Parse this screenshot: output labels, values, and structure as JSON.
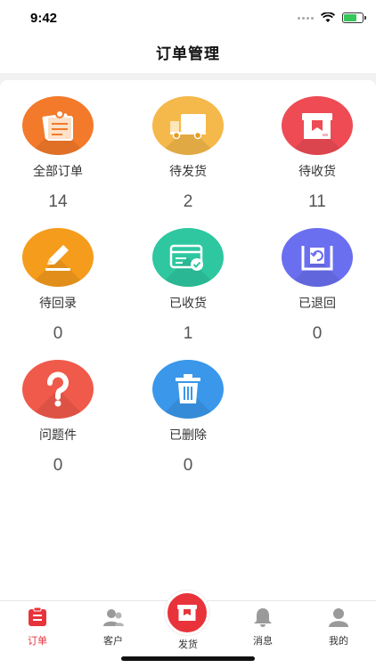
{
  "status_bar": {
    "time": "9:42"
  },
  "header": {
    "title": "订单管理"
  },
  "grid": [
    {
      "label": "全部订单",
      "count": "14",
      "icon": "clipboard-icon",
      "color": "#f27a2a"
    },
    {
      "label": "待发货",
      "count": "2",
      "icon": "delivery-truck-icon",
      "color": "#f5b84a"
    },
    {
      "label": "待收货",
      "count": "11",
      "icon": "package-box-icon",
      "color": "#ee4b55"
    },
    {
      "label": "待回录",
      "count": "0",
      "icon": "pencil-icon",
      "color": "#f59c1d"
    },
    {
      "label": "已收货",
      "count": "1",
      "icon": "card-check-icon",
      "color": "#2ec7a0"
    },
    {
      "label": "已退回",
      "count": "0",
      "icon": "return-tray-icon",
      "color": "#6a6ff0"
    },
    {
      "label": "问题件",
      "count": "0",
      "icon": "question-mark-icon",
      "color": "#f05a4b"
    },
    {
      "label": "已删除",
      "count": "0",
      "icon": "trash-icon",
      "color": "#3a97ea"
    }
  ],
  "tabs": {
    "orders": "订单",
    "customers": "客户",
    "ship": "发货",
    "messages": "消息",
    "mine": "我的"
  },
  "colors": {
    "accent": "#e8333b",
    "inactive_icon": "#9a9a9a"
  }
}
